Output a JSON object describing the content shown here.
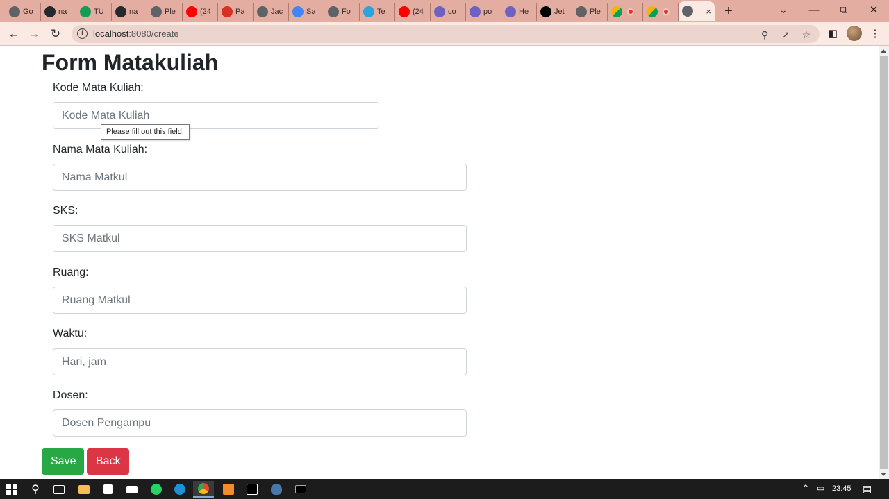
{
  "browser": {
    "tabs": [
      {
        "title": "Go",
        "icon": "globe-icon",
        "color": "#5f6368"
      },
      {
        "title": "na",
        "icon": "github-icon",
        "color": "#24292e"
      },
      {
        "title": "TU",
        "icon": "sheets-icon",
        "color": "#0f9d58"
      },
      {
        "title": "na",
        "icon": "github-icon",
        "color": "#24292e"
      },
      {
        "title": "Ple",
        "icon": "globe-icon",
        "color": "#5f6368"
      },
      {
        "title": "(24",
        "icon": "youtube-icon",
        "color": "#ff0000"
      },
      {
        "title": "Pa",
        "icon": "gmail-icon",
        "color": "#d93025"
      },
      {
        "title": "Jac",
        "icon": "globe-icon",
        "color": "#5f6368"
      },
      {
        "title": "Sa",
        "icon": "google-icon",
        "color": "#4285f4"
      },
      {
        "title": "Fo",
        "icon": "globe-icon",
        "color": "#5f6368"
      },
      {
        "title": "Te",
        "icon": "telegram-icon",
        "color": "#2aa3de"
      },
      {
        "title": "(24",
        "icon": "youtube-icon",
        "color": "#ff0000"
      },
      {
        "title": "co",
        "icon": "heroku-icon",
        "color": "#6f61c0"
      },
      {
        "title": "po",
        "icon": "heroku-icon",
        "color": "#6f61c0"
      },
      {
        "title": "He",
        "icon": "heroku-icon",
        "color": "#6f61c0"
      },
      {
        "title": "Jet",
        "icon": "jetbrains-icon",
        "color": "#000000"
      },
      {
        "title": "Ple",
        "icon": "globe-icon",
        "color": "#5f6368"
      }
    ],
    "active_tab_close": "×",
    "new_tab": "+",
    "url_host": "localhost",
    "url_path": ":8080/create"
  },
  "form": {
    "title": "Form Matakuliah",
    "fields": [
      {
        "label": "Kode Mata Kuliah:",
        "placeholder": "Kode Mata Kuliah",
        "value": ""
      },
      {
        "label": "Nama Mata Kuliah:",
        "placeholder": "Nama Matkul",
        "value": ""
      },
      {
        "label": "SKS:",
        "placeholder": "SKS Matkul",
        "value": ""
      },
      {
        "label": "Ruang:",
        "placeholder": "Ruang Matkul",
        "value": ""
      },
      {
        "label": "Waktu:",
        "placeholder": "Hari, jam",
        "value": ""
      },
      {
        "label": "Dosen:",
        "placeholder": "Dosen Pengampu",
        "value": ""
      }
    ],
    "validation_tooltip": "Please fill out this field.",
    "save_label": "Save",
    "back_label": "Back",
    "save_color": "#28a745",
    "back_color": "#dc3545"
  },
  "taskbar": {
    "clock": "23:45"
  }
}
